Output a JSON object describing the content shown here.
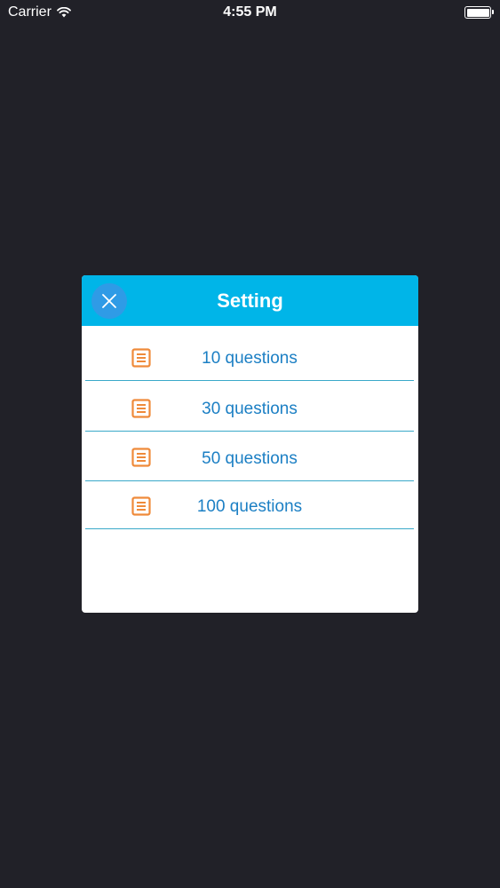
{
  "status_bar": {
    "carrier": "Carrier",
    "time": "4:55 PM",
    "wifi_icon": "wifi-icon",
    "battery_icon": "battery-icon"
  },
  "dialog": {
    "title": "Setting",
    "close_icon": "close-icon",
    "options": [
      {
        "label": "10 questions",
        "icon": "list-icon"
      },
      {
        "label": "30 questions",
        "icon": "list-icon"
      },
      {
        "label": "50 questions",
        "icon": "list-icon"
      },
      {
        "label": "100 questions",
        "icon": "list-icon"
      }
    ]
  },
  "colors": {
    "background": "#212128",
    "header": "#00b5e8",
    "close_button": "#2f9be6",
    "option_text": "#1b7fc4",
    "divider": "#3aa9c9",
    "icon": "#ef8a3a"
  }
}
